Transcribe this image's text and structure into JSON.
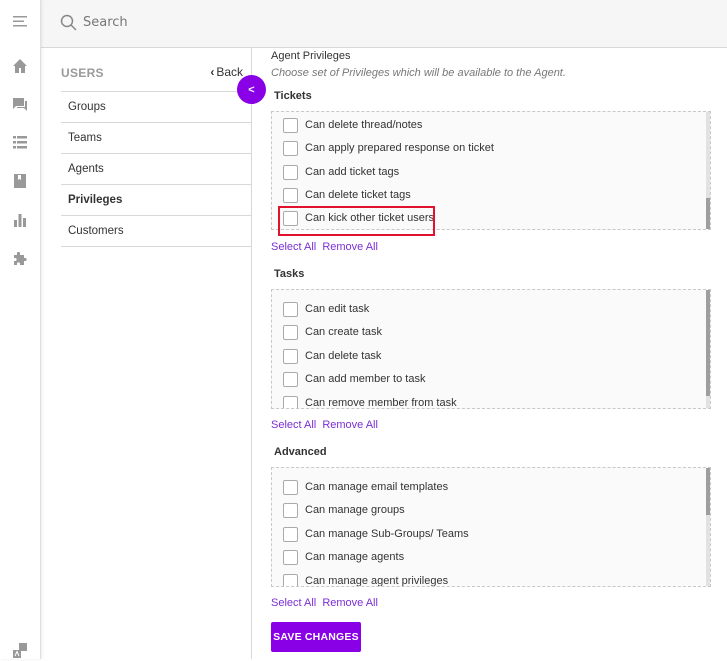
{
  "rail": {
    "icons": [
      "menu-icon",
      "home-icon",
      "chat-icon",
      "list-icon",
      "bookmark-icon",
      "bar-chart-icon",
      "puzzle-icon",
      "translate-icon"
    ]
  },
  "header": {
    "search_placeholder": "Search"
  },
  "subnav": {
    "title": "USERS",
    "back_label": "Back",
    "items": [
      {
        "label": "Groups"
      },
      {
        "label": "Teams"
      },
      {
        "label": "Agents"
      },
      {
        "label": "Privileges",
        "active": true
      },
      {
        "label": "Customers"
      }
    ]
  },
  "main": {
    "heading": "Agent Privileges",
    "subheading": "Choose set of Privileges which will be available to the Agent.",
    "sections": [
      {
        "title": "Tickets",
        "options": [
          {
            "label": "Can delete thread/notes",
            "checked": false
          },
          {
            "label": "Can apply prepared response on ticket",
            "checked": false
          },
          {
            "label": "Can add ticket tags",
            "checked": false
          },
          {
            "label": "Can delete ticket tags",
            "checked": false
          },
          {
            "label": "Can kick other ticket users",
            "checked": false
          }
        ]
      },
      {
        "title": "Tasks",
        "options": [
          {
            "label": "Can edit task",
            "checked": false
          },
          {
            "label": "Can create task",
            "checked": false
          },
          {
            "label": "Can delete task",
            "checked": false
          },
          {
            "label": "Can add member to task",
            "checked": false
          },
          {
            "label": "Can remove member from task",
            "checked": false
          }
        ]
      },
      {
        "title": "Advanced",
        "options": [
          {
            "label": "Can manage email templates",
            "checked": false
          },
          {
            "label": "Can manage groups",
            "checked": false
          },
          {
            "label": "Can manage Sub-Groups/ Teams",
            "checked": false
          },
          {
            "label": "Can manage agents",
            "checked": false
          },
          {
            "label": "Can manage agent privileges",
            "checked": false
          }
        ]
      }
    ],
    "select_all_label": "Select All",
    "remove_all_label": "Remove All",
    "save_label": "SAVE CHANGES"
  },
  "colors": {
    "accent": "#8a00e6",
    "link": "#7a2fd4",
    "highlight": "#e2112e"
  }
}
